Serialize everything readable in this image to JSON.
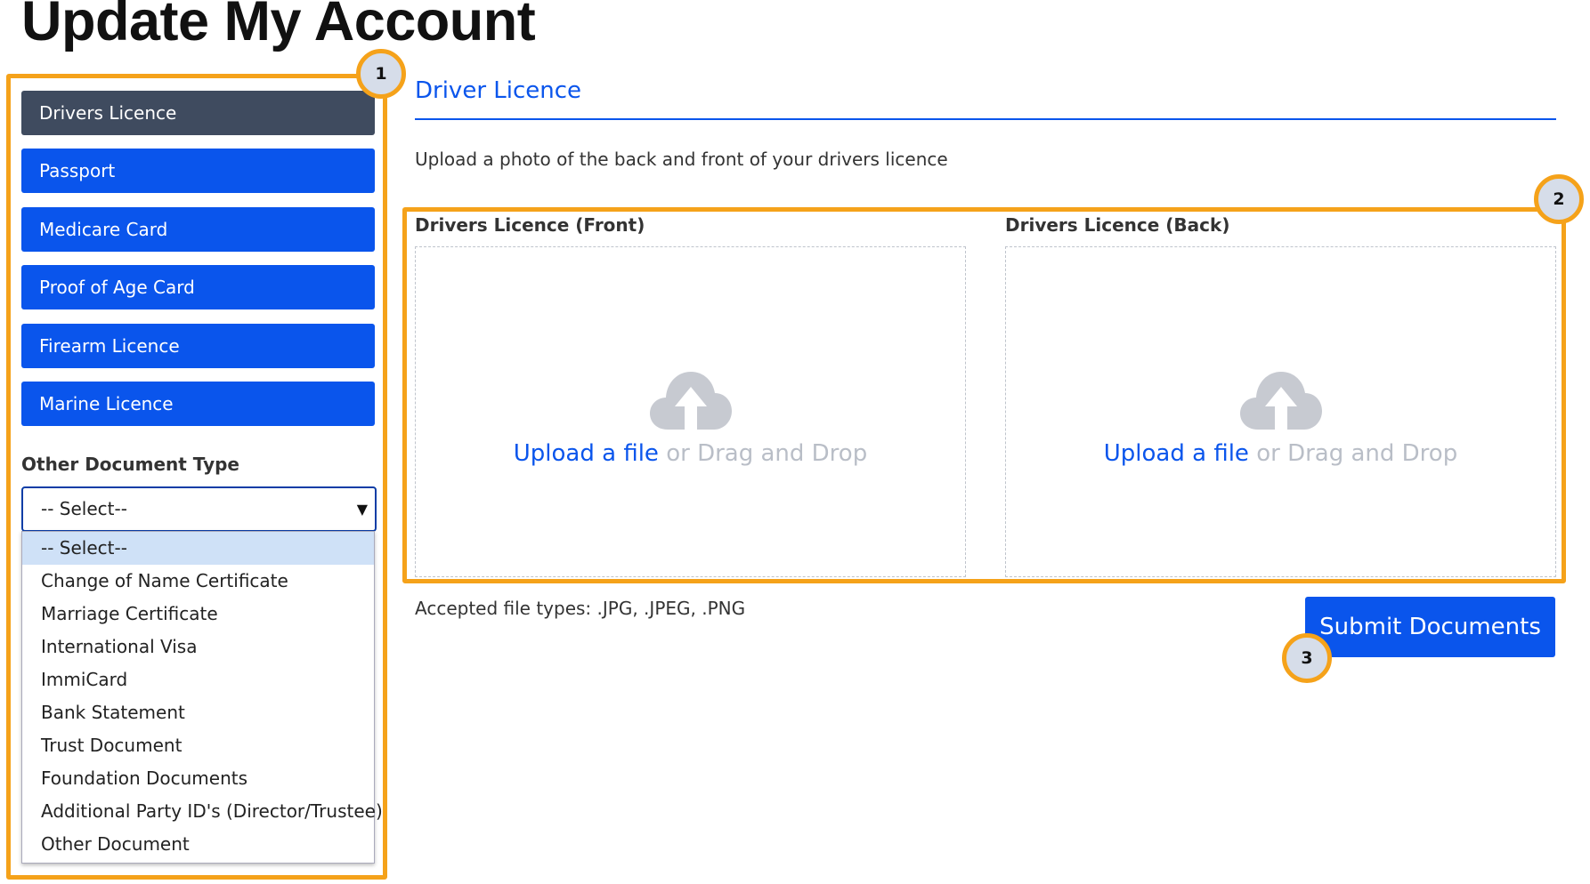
{
  "page": {
    "title": "Update My Account"
  },
  "sidebar": {
    "items": [
      {
        "label": "Drivers Licence",
        "active": true
      },
      {
        "label": "Passport",
        "active": false
      },
      {
        "label": "Medicare Card",
        "active": false
      },
      {
        "label": "Proof of Age Card",
        "active": false
      },
      {
        "label": "Firearm Licence",
        "active": false
      },
      {
        "label": "Marine Licence",
        "active": false
      }
    ],
    "other_label": "Other Document Type",
    "select_value": "-- Select--",
    "options": [
      "-- Select--",
      "Change of Name Certificate",
      "Marriage Certificate",
      "International Visa",
      "ImmiCard",
      "Bank Statement",
      "Trust Document",
      "Foundation Documents",
      "Additional Party ID's (Director/Trustee)",
      "Other Document"
    ]
  },
  "main": {
    "section_title": "Driver Licence",
    "description": "Upload a photo of the back and front of your drivers licence",
    "uploads": [
      {
        "label": "Drivers Licence (Front)",
        "link_text": "Upload a file",
        "rest_text": " or Drag and Drop",
        "icon": "cloud-upload-icon"
      },
      {
        "label": "Drivers Licence (Back)",
        "link_text": "Upload a file",
        "rest_text": " or Drag and Drop",
        "icon": "cloud-upload-icon"
      }
    ],
    "accepted": "Accepted file types: .JPG, .JPEG, .PNG",
    "submit_label": "Submit Documents"
  },
  "callouts": [
    "1",
    "2",
    "3"
  ],
  "colors": {
    "primary": "#0a55ec",
    "active_nav": "#3f4b5f",
    "callout": "#f5a21a",
    "callout_fill": "#d6dde9"
  }
}
